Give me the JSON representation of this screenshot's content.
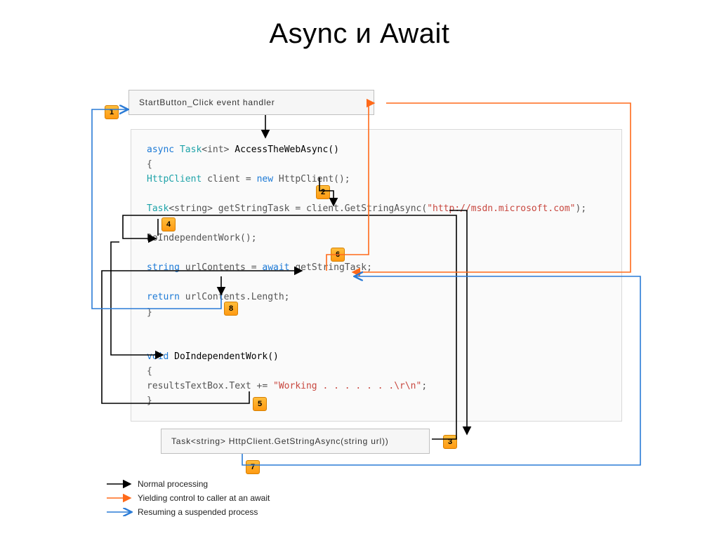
{
  "title": "Async и Await",
  "boxes": {
    "top_handler": "StartButton_Click event handler",
    "bottom_call": "Task<string> HttpClient.GetStringAsync(string url))"
  },
  "code": {
    "l1a": "async",
    "l1b": "Task",
    "l1c": "<int>",
    "l1d": " AccessTheWebAsync()",
    "l2": "{",
    "l3a": "    HttpClient",
    "l3b": " client = ",
    "l3c": "new",
    "l3d": " HttpClient();",
    "l5a": "    Task",
    "l5b": "<string>",
    "l5c": " getStringTask = client.GetStringAsync(",
    "l5d": "\"http://msdn.microsoft.com\"",
    "l5e": ");",
    "l7": "    DoIndependentWork();",
    "l9a": "    string",
    "l9b": " urlContents = ",
    "l9c": "await",
    "l9d": " getStringTask;",
    "l11a": "    return",
    "l11b": " urlContents.Length;",
    "l12": "}",
    "l14a": "void",
    "l14b": " DoIndependentWork()",
    "l15": "{",
    "l16a": "    resultsTextBox.Text += ",
    "l16b": "\"Working . . . . . . .\\r\\n\"",
    "l16c": ";",
    "l17": "}"
  },
  "badges": {
    "b1": "1",
    "b2": "2",
    "b3": "3",
    "b4": "4",
    "b5": "5",
    "b6": "6",
    "b7": "7",
    "b8": "8"
  },
  "legend": {
    "l1": "Normal processing",
    "l2": "Yielding control to caller at an await",
    "l3": "Resuming a suspended process"
  },
  "colors": {
    "black": "#000000",
    "orange": "#ff6a1a",
    "blue": "#2a7bd6"
  }
}
